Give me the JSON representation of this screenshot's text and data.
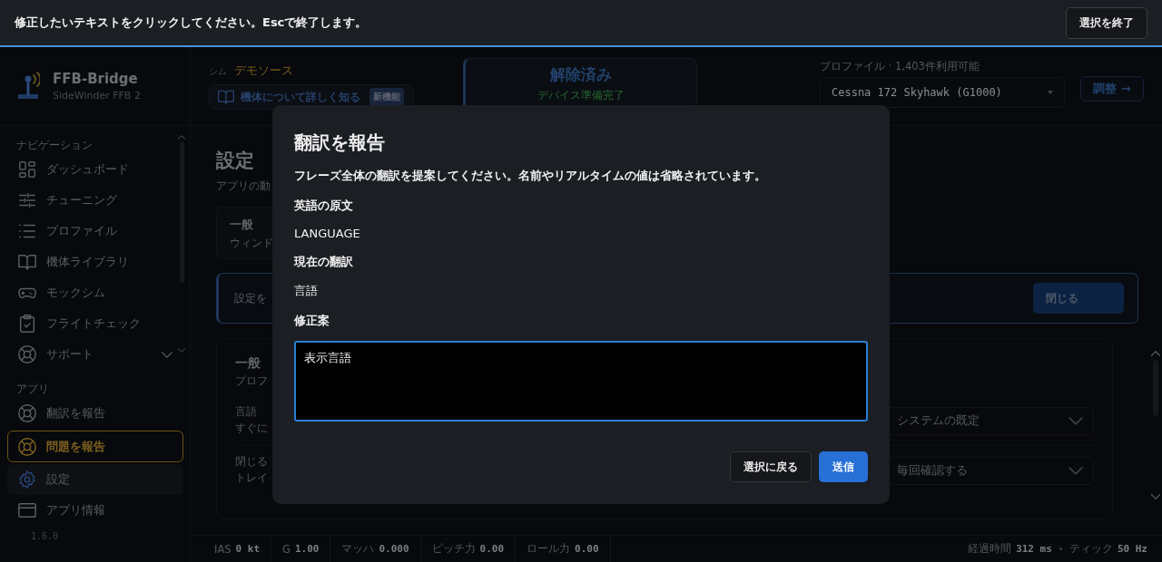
{
  "selection_bar": {
    "message": "修正したいテキストをクリックしてください。Escで終了します。",
    "button": "選択を終了"
  },
  "app": {
    "name": "FFB-Bridge",
    "device": "SideWinder FFB 2"
  },
  "sim": {
    "label": "シム",
    "value": "デモソース",
    "learn_button": "機体について詳しく知る",
    "badge": "新機能"
  },
  "status_card": {
    "title": "解除済み",
    "subtitle": "デバイス準備完了"
  },
  "profile": {
    "label": "プロファイル · 1,403件利用可能",
    "value": "Cessna 172 Skyhawk (G1000)",
    "button": "調整 →"
  },
  "sidebar": {
    "sections": [
      {
        "title": "ナビゲーション",
        "items": [
          {
            "label": "ダッシュボード",
            "kind": "normal",
            "selected": false,
            "collapsible": false
          },
          {
            "label": "チューニング",
            "kind": "normal",
            "selected": false,
            "collapsible": false
          },
          {
            "label": "プロファイル",
            "kind": "normal",
            "selected": false,
            "collapsible": false
          },
          {
            "label": "機体ライブラリ",
            "kind": "normal",
            "selected": false,
            "collapsible": false
          },
          {
            "label": "モックシム",
            "kind": "normal",
            "selected": false,
            "collapsible": false
          },
          {
            "label": "フライトチェック",
            "kind": "normal",
            "selected": false,
            "collapsible": false
          },
          {
            "label": "サポート",
            "kind": "normal",
            "selected": false,
            "collapsible": true
          }
        ]
      },
      {
        "title": "アプリ",
        "items": [
          {
            "label": "翻訳を報告",
            "kind": "normal",
            "selected": false,
            "collapsible": false
          },
          {
            "label": "問題を報告",
            "kind": "alert",
            "selected": false,
            "collapsible": false
          },
          {
            "label": "設定",
            "kind": "normal",
            "selected": true,
            "collapsible": false
          },
          {
            "label": "アプリ情報",
            "kind": "normal",
            "selected": false,
            "collapsible": false
          }
        ]
      }
    ],
    "version": "1.6.0"
  },
  "page": {
    "title": "設定",
    "subtitle": "アプリの動",
    "tab": {
      "title": "一般",
      "description": "ウィンド"
    },
    "banner": {
      "text": "設定を",
      "button": "閉じる"
    },
    "settings_card": {
      "title": "一般",
      "subtitle": "プロフ",
      "rows": [
        {
          "label": "言語",
          "description": "すぐに",
          "value": "システムの既定"
        },
        {
          "label": "閉じる",
          "description": "トレイ",
          "value": "毎回確認する"
        }
      ]
    }
  },
  "status_bar": {
    "left": [
      {
        "label": "IAS",
        "value": "0 kt"
      },
      {
        "label": "G",
        "value": "1.00"
      },
      {
        "label": "マッハ",
        "value": "0.000"
      },
      {
        "label": "ピッチ力",
        "value": "0.00"
      },
      {
        "label": "ロール力",
        "value": "0.00"
      }
    ],
    "right": [
      {
        "label": "経過時間",
        "value": "312 ms"
      },
      {
        "label": "ティック",
        "value": "50 Hz"
      }
    ]
  },
  "dialog": {
    "title": "翻訳を報告",
    "description": "フレーズ全体の翻訳を提案してください。名前やリアルタイムの値は省略されています。",
    "fields": [
      {
        "label": "英語の原文",
        "value": "LANGUAGE"
      },
      {
        "label": "現在の翻訳",
        "value": "言語"
      }
    ],
    "suggestion": {
      "label": "修正案",
      "value": "表示言語"
    },
    "buttons": [
      {
        "label": "選択に戻る",
        "kind": "secondary"
      },
      {
        "label": "送信",
        "kind": "primary"
      }
    ]
  }
}
